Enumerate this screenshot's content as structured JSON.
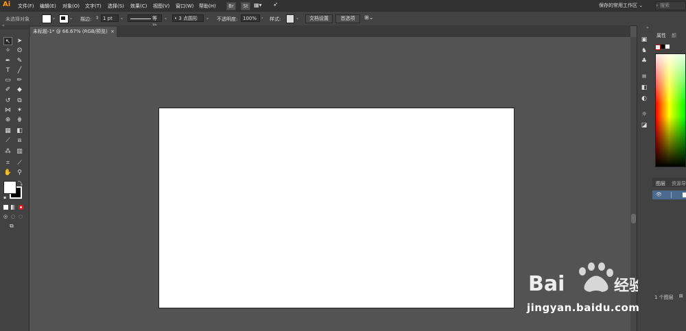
{
  "app": {
    "logo": "Ai",
    "workspace": "保存的常用工作区",
    "search_placeholder": "搜索"
  },
  "menu": [
    "文件(F)",
    "编辑(E)",
    "对象(O)",
    "文字(T)",
    "选择(S)",
    "效果(C)",
    "视图(V)",
    "窗口(W)",
    "帮助(H)"
  ],
  "menubar_buttons": {
    "br": "Br",
    "st": "St"
  },
  "control": {
    "status": "未选择对象",
    "stroke_label": "描边:",
    "stroke_value": "1 pt",
    "uniform": "等比",
    "brush": "3 点圆形",
    "opacity_label": "不透明度:",
    "opacity_value": "100%",
    "style_label": "样式:",
    "doc_setup": "文档设置",
    "prefs": "首选项"
  },
  "document": {
    "tab_title": "未标题-1* @ 66.67% (RGB/预览)",
    "close": "×"
  },
  "right_panel": {
    "props_tab": "属性",
    "layers_tab": "图层",
    "assets_tab": "资源导出",
    "layer_count": "1 个图层"
  },
  "watermark": {
    "logo": "Bai 经验",
    "url": "jingyan.baidu.com"
  },
  "colors": {
    "accent_logo": "#ff9a00",
    "artboard": "#ffffff",
    "canvas": "#535353",
    "layer_highlight": "#4b6a8e"
  }
}
